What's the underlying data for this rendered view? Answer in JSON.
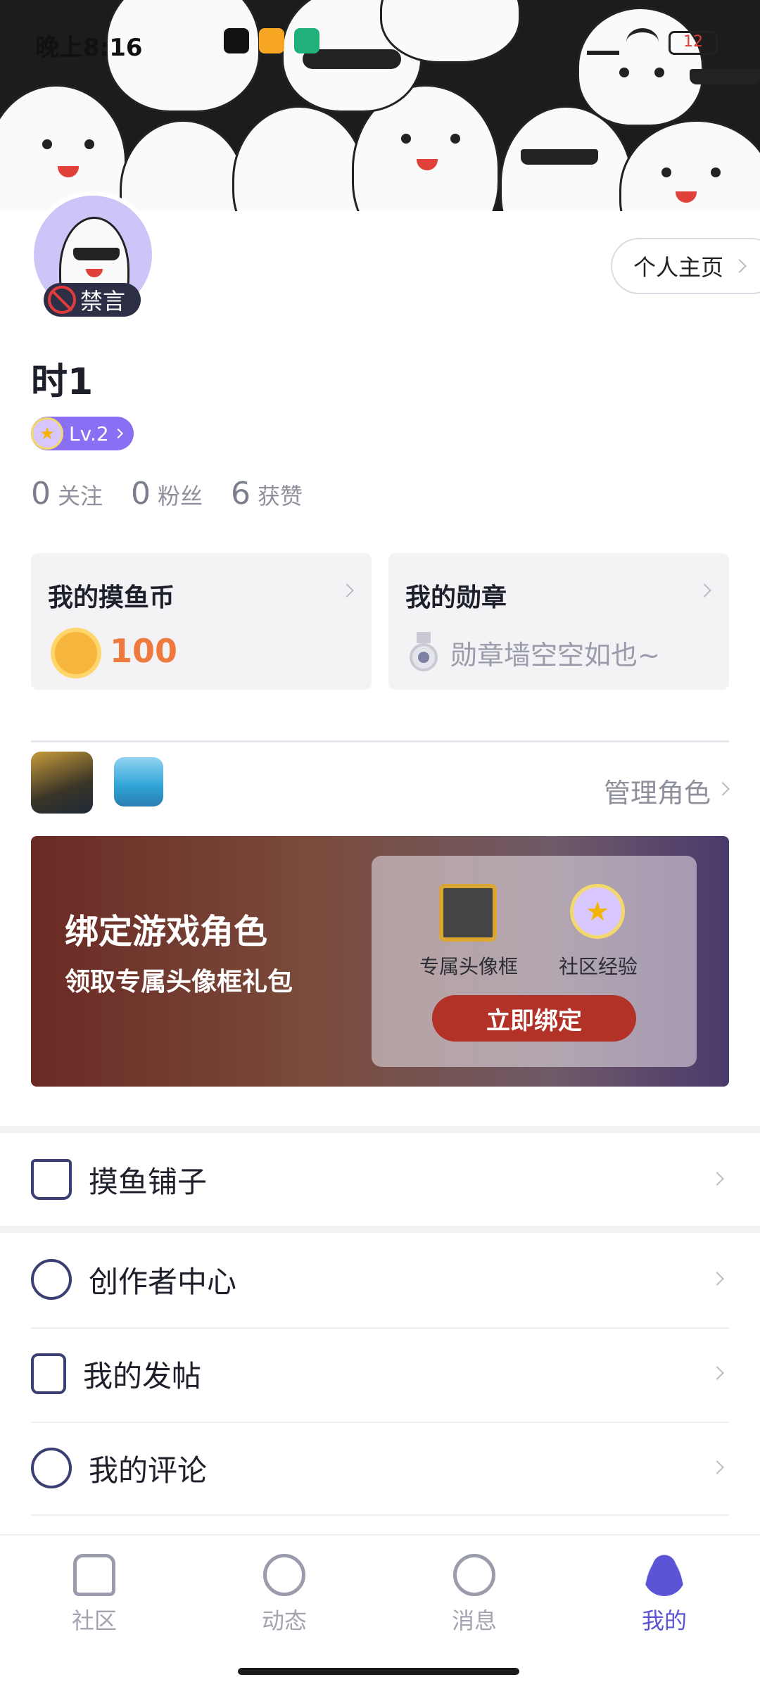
{
  "status_bar": {
    "time": "晚上8:16",
    "battery": "12"
  },
  "profile": {
    "mute_badge": "禁言",
    "home_button": "个人主页",
    "username": "时1",
    "level": "Lv.2",
    "stats": [
      {
        "value": "0",
        "label": "关注"
      },
      {
        "value": "0",
        "label": "粉丝"
      },
      {
        "value": "6",
        "label": "获赞"
      }
    ]
  },
  "cards": {
    "coins_title": "我的摸鱼币",
    "coins_value": "100",
    "medals_title": "我的勋章",
    "medals_empty": "勋章墙空空如也~"
  },
  "games": {
    "manage_label": "管理角色",
    "icons": [
      "pubg-game-icon",
      "island-game-icon"
    ]
  },
  "bind_banner": {
    "title": "绑定游戏角色",
    "subtitle": "领取专属头像框礼包",
    "reward_frame": "专属头像框",
    "reward_exp": "社区经验",
    "button": "立即绑定"
  },
  "menu": [
    {
      "label": "摸鱼铺子",
      "icon": "shop-icon"
    },
    {
      "label": "创作者中心",
      "icon": "palette-icon"
    },
    {
      "label": "我的发帖",
      "icon": "document-icon"
    },
    {
      "label": "我的评论",
      "icon": "comment-icon"
    }
  ],
  "tabs": [
    {
      "label": "社区",
      "icon": "home-icon"
    },
    {
      "label": "动态",
      "icon": "compass-icon"
    },
    {
      "label": "消息",
      "icon": "chat-icon"
    },
    {
      "label": "我的",
      "icon": "user-icon"
    }
  ],
  "colors": {
    "accent": "#5b55d6",
    "coin": "#f07a3e",
    "bind_button": "#b33228"
  }
}
